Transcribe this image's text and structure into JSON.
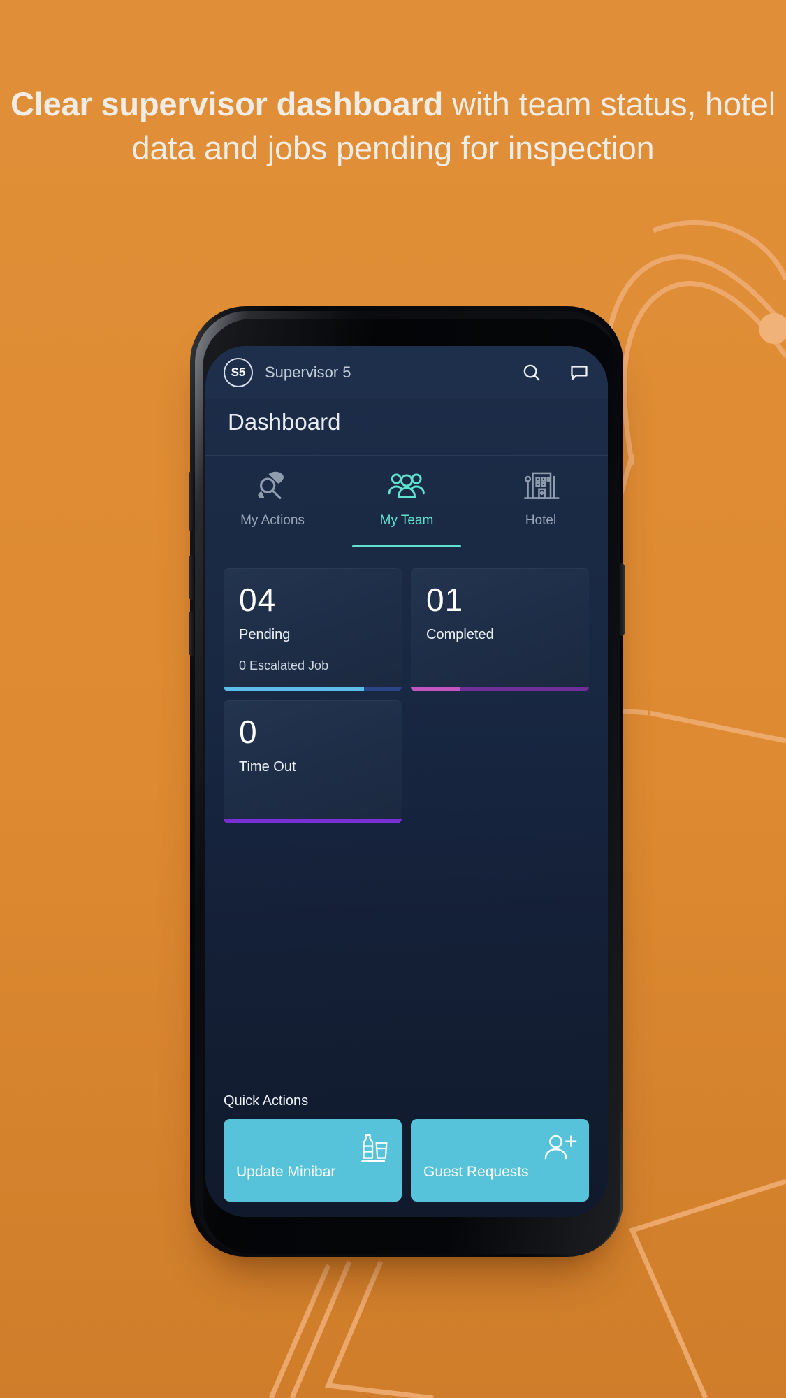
{
  "background": {
    "color": "#df8a33",
    "decoration_color": "#eeab70"
  },
  "headline": {
    "bold_part": "Clear supervisor dashboard",
    "rest": " with team status, hotel data and jobs pending for inspection",
    "color": "#f3ece4"
  },
  "app": {
    "appbar": {
      "avatar_initials": "S5",
      "title": "Supervisor 5",
      "search_icon": "search-icon",
      "chat_icon": "chat-bubble-icon"
    },
    "page_title": "Dashboard",
    "tabs": [
      {
        "label": "My Actions",
        "icon": "inspection-magnifier-icon",
        "active": false
      },
      {
        "label": "My Team",
        "icon": "people-group-icon",
        "active": true
      },
      {
        "label": "Hotel",
        "icon": "hotel-building-icon",
        "active": false
      }
    ],
    "tab_active_color": "#5fe3cf",
    "cards": [
      {
        "value": "04",
        "label": "Pending",
        "sub": "0 Escalated Job",
        "bar_fill_pct": 79,
        "bar_fill_color": "#5bbde8",
        "bar_track_color": "#2b4486"
      },
      {
        "value": "01",
        "label": "Completed",
        "sub": "",
        "bar_fill_pct": 28,
        "bar_fill_color": "#c255c0",
        "bar_track_color": "#6d2f96"
      },
      {
        "value": "0",
        "label": "Time Out",
        "sub": "",
        "bar_fill_pct": 100,
        "bar_fill_color": "#7a2fd4",
        "bar_track_color": "#7a2fd4"
      }
    ],
    "quick_actions": {
      "title": "Quick Actions",
      "items": [
        {
          "label": "Update Minibar",
          "icon": "bottle-glass-icon"
        },
        {
          "label": "Guest Requests",
          "icon": "person-add-icon"
        }
      ],
      "card_color": "#56c3da"
    }
  }
}
